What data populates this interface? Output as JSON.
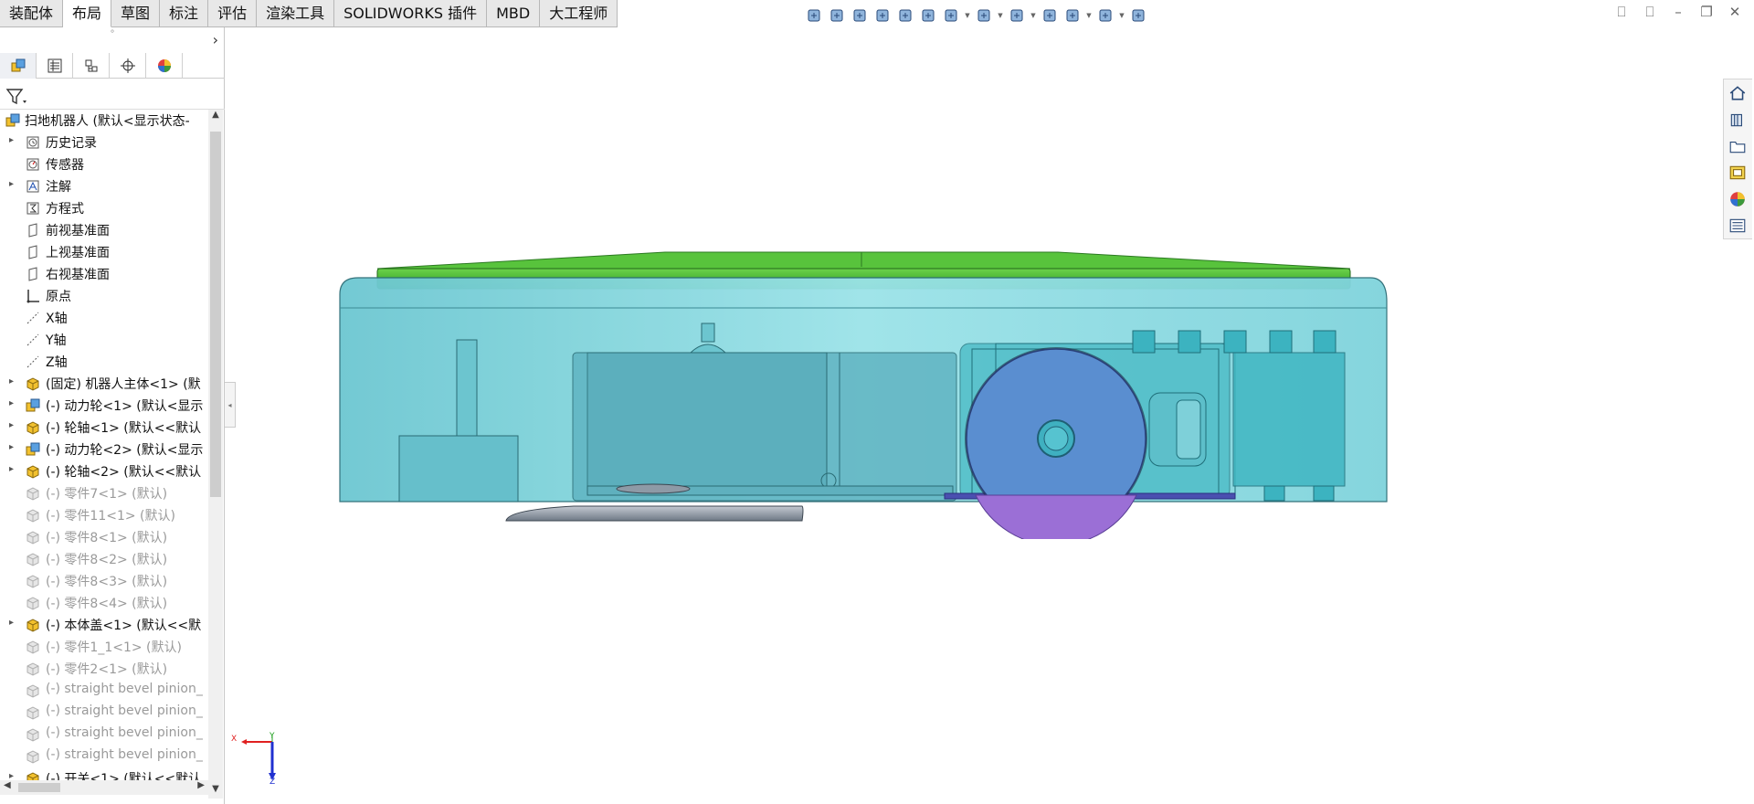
{
  "tabs": [
    {
      "label": "装配体",
      "active": false
    },
    {
      "label": "布局",
      "active": true
    },
    {
      "label": "草图",
      "active": false
    },
    {
      "label": "标注",
      "active": false
    },
    {
      "label": "评估",
      "active": false
    },
    {
      "label": "渲染工具",
      "active": false
    },
    {
      "label": "SOLIDWORKS 插件",
      "active": false
    },
    {
      "label": "MBD",
      "active": false
    },
    {
      "label": "大工程师",
      "active": false
    }
  ],
  "panel": {
    "splitter_glyph": "°",
    "tabs": [
      "featuremanager-icon",
      "propertymanager-icon",
      "configurationmanager-icon",
      "dimxpert-icon",
      "appearance-icon"
    ],
    "more_glyph": "›"
  },
  "tree": [
    {
      "label": "扫地机器人  (默认<显示状态-",
      "icon": "assembly-icon",
      "state": "normal",
      "level": 0,
      "expand": ""
    },
    {
      "label": "历史记录",
      "icon": "history-icon",
      "state": "normal",
      "level": 1,
      "expand": "▸"
    },
    {
      "label": "传感器",
      "icon": "sensor-icon",
      "state": "normal",
      "level": 1,
      "expand": ""
    },
    {
      "label": "注解",
      "icon": "annotation-icon",
      "state": "normal",
      "level": 1,
      "expand": "▸"
    },
    {
      "label": "方程式",
      "icon": "equation-icon",
      "state": "normal",
      "level": 1,
      "expand": ""
    },
    {
      "label": "前视基准面",
      "icon": "plane-icon",
      "state": "normal",
      "level": 1,
      "expand": ""
    },
    {
      "label": "上视基准面",
      "icon": "plane-icon",
      "state": "normal",
      "level": 1,
      "expand": ""
    },
    {
      "label": "右视基准面",
      "icon": "plane-icon",
      "state": "normal",
      "level": 1,
      "expand": ""
    },
    {
      "label": "原点",
      "icon": "origin-icon",
      "state": "normal",
      "level": 1,
      "expand": ""
    },
    {
      "label": "X轴",
      "icon": "axis-icon",
      "state": "normal",
      "level": 1,
      "expand": ""
    },
    {
      "label": "Y轴",
      "icon": "axis-icon",
      "state": "normal",
      "level": 1,
      "expand": ""
    },
    {
      "label": "Z轴",
      "icon": "axis-icon",
      "state": "normal",
      "level": 1,
      "expand": ""
    },
    {
      "label": "(固定) 机器人主体<1> (默",
      "icon": "part-icon",
      "state": "normal",
      "level": 1,
      "expand": "▸"
    },
    {
      "label": "(-) 动力轮<1> (默认<显示",
      "icon": "subassembly-icon",
      "state": "normal",
      "level": 1,
      "expand": "▸"
    },
    {
      "label": "(-) 轮轴<1> (默认<<默认",
      "icon": "part-icon",
      "state": "normal",
      "level": 1,
      "expand": "▸"
    },
    {
      "label": "(-) 动力轮<2> (默认<显示",
      "icon": "subassembly-icon",
      "state": "normal",
      "level": 1,
      "expand": "▸"
    },
    {
      "label": "(-) 轮轴<2> (默认<<默认",
      "icon": "part-icon",
      "state": "normal",
      "level": 1,
      "expand": "▸"
    },
    {
      "label": "(-) 零件7<1> (默认)",
      "icon": "suppressed-part-icon",
      "state": "suppressed",
      "level": 1,
      "expand": ""
    },
    {
      "label": "(-) 零件11<1> (默认)",
      "icon": "suppressed-part-icon",
      "state": "suppressed",
      "level": 1,
      "expand": ""
    },
    {
      "label": "(-) 零件8<1> (默认)",
      "icon": "suppressed-part-icon",
      "state": "suppressed",
      "level": 1,
      "expand": ""
    },
    {
      "label": "(-) 零件8<2> (默认)",
      "icon": "suppressed-part-icon",
      "state": "suppressed",
      "level": 1,
      "expand": ""
    },
    {
      "label": "(-) 零件8<3> (默认)",
      "icon": "suppressed-part-icon",
      "state": "suppressed",
      "level": 1,
      "expand": ""
    },
    {
      "label": "(-) 零件8<4> (默认)",
      "icon": "suppressed-part-icon",
      "state": "suppressed",
      "level": 1,
      "expand": ""
    },
    {
      "label": "(-) 本体盖<1> (默认<<默",
      "icon": "part-icon",
      "state": "normal",
      "level": 1,
      "expand": "▸"
    },
    {
      "label": "(-) 零件1_1<1> (默认)",
      "icon": "suppressed-part-icon",
      "state": "suppressed",
      "level": 1,
      "expand": ""
    },
    {
      "label": "(-) 零件2<1> (默认)",
      "icon": "suppressed-part-icon",
      "state": "suppressed",
      "level": 1,
      "expand": ""
    },
    {
      "label": "(-) straight bevel pinion_",
      "icon": "suppressed-part-icon",
      "state": "suppressed",
      "level": 1,
      "expand": ""
    },
    {
      "label": "(-) straight bevel pinion_",
      "icon": "suppressed-part-icon",
      "state": "suppressed",
      "level": 1,
      "expand": ""
    },
    {
      "label": "(-) straight bevel pinion_",
      "icon": "suppressed-part-icon",
      "state": "suppressed",
      "level": 1,
      "expand": ""
    },
    {
      "label": "(-) straight bevel pinion_",
      "icon": "suppressed-part-icon",
      "state": "suppressed",
      "level": 1,
      "expand": ""
    },
    {
      "label": "(-) 开关<1> (默认<<默认",
      "icon": "part-icon",
      "state": "normal",
      "level": 1,
      "expand": "▸"
    }
  ],
  "hud_icons": [
    "view-orientation-icon",
    "zoom-to-fit-icon",
    "zoom-area-icon",
    "previous-view-icon",
    "section-view-icon",
    "dynamic-annotation-icon",
    "view-orientation-cube-icon",
    "display-style-icon",
    "hide-show-icon",
    "edit-appearance-icon",
    "apply-scene-icon",
    "view-settings-icon",
    "3d-view-icon"
  ],
  "window_controls": [
    "⎕",
    "⎕",
    "–",
    "❐",
    "✕"
  ],
  "task_pane_icons": [
    "home-icon",
    "design-library-icon",
    "file-explorer-icon",
    "view-palette-icon",
    "appearances-icon",
    "custom-properties-icon"
  ],
  "triad": {
    "x_label": "X",
    "y_label": "Y",
    "z_label": "Z"
  },
  "colors": {
    "body": "#7fd3dc",
    "lid": "#3fb52f",
    "wheel": "#5a8ed0",
    "wheel_lower": "#9b6fd6",
    "brush": "#8e9aa6",
    "motor": "#46b9c4"
  }
}
